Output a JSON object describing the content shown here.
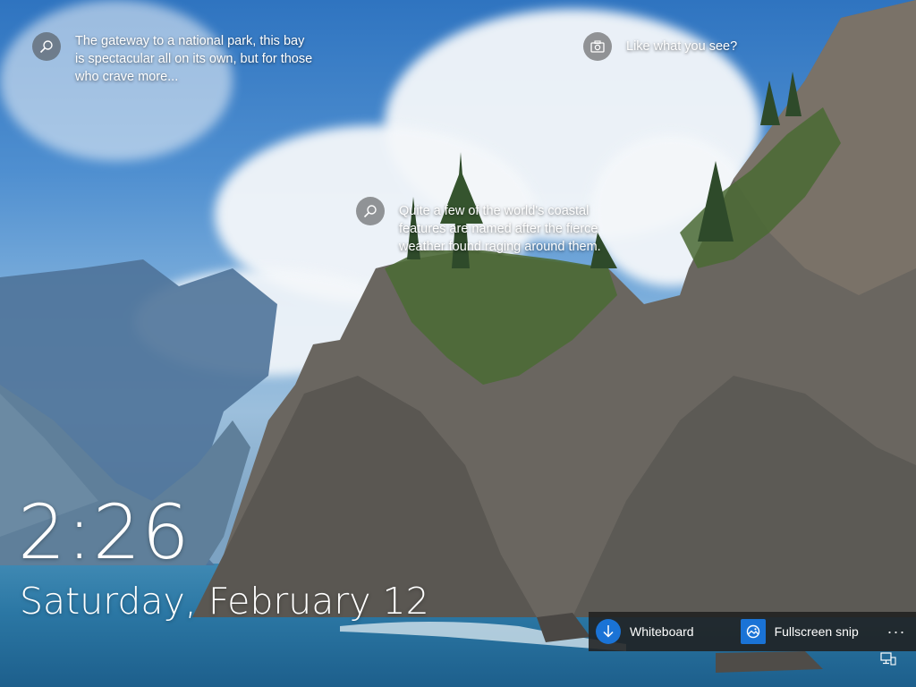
{
  "spotlight": {
    "hotspots": [
      {
        "icon": "search-icon",
        "text": "The gateway to a national park, this bay\nis spectacular all on its own, but for those\nwho crave more..."
      },
      {
        "icon": "camera-icon",
        "text": "Like what you see?"
      },
      {
        "icon": "search-icon",
        "text": "Quite a few of the world's coastal\nfeatures are named after the fierce\nweather found raging around them."
      }
    ]
  },
  "clock": {
    "time": "2:26",
    "date": "Saturday, February 12"
  },
  "actions": {
    "items": [
      {
        "label": "Whiteboard",
        "icon": "download-arrow-icon",
        "color": "#1a73d6"
      },
      {
        "label": "Fullscreen snip",
        "icon": "screenshot-image-icon",
        "color": "#1a73d6"
      }
    ],
    "more": "···"
  },
  "status": {
    "network_icon": "network-icon"
  }
}
